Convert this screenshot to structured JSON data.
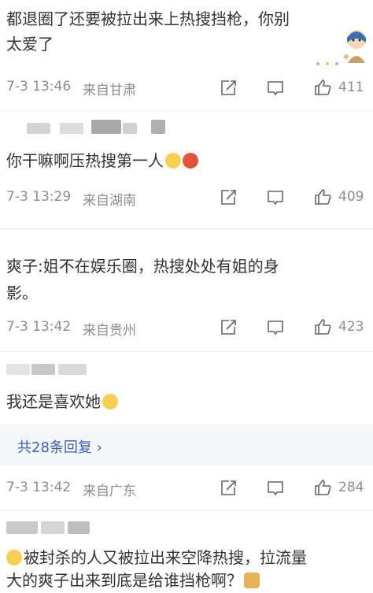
{
  "comments": [
    {
      "text_line1": "都退圈了还要被拉出来上热搜挡枪，你别",
      "text_line2": "太爱了",
      "date": "7-3 13:46",
      "location": "来自甘肃",
      "likes": "411"
    },
    {
      "text_line1": "你干嘛啊压热搜第一人",
      "date": "7-3 13:29",
      "location": "来自湖南",
      "likes": "409"
    },
    {
      "text_line1": "爽子:姐不在娱乐圈，热搜处处有姐的身",
      "text_line2": "影。",
      "date": "7-3 13:42",
      "location": "来自贵州",
      "likes": "423"
    },
    {
      "text_line1": "我还是喜欢她",
      "reply_link": "共28条回复 ›",
      "date": "7-3 13:42",
      "location": "来自广东",
      "likes": "284"
    },
    {
      "text_line1": "被封杀的人又被拉出来空降热搜，拉流量",
      "text_line2": "大的爽子出来到底是给谁挡枪啊？"
    }
  ],
  "colors": {
    "text": "#333333",
    "meta": "#8e8e8e",
    "link": "#3f62b1",
    "reply_bg": "#f5f6f8"
  },
  "icons": [
    "repost-icon",
    "comment-icon",
    "like-icon"
  ]
}
